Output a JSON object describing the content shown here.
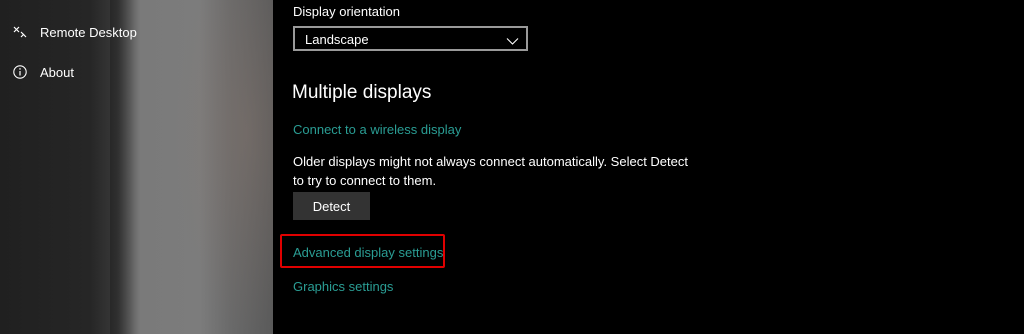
{
  "sidebar": {
    "items": [
      {
        "label": "Remote Desktop",
        "icon": "remote-desktop-icon"
      },
      {
        "label": "About",
        "icon": "info-icon"
      }
    ]
  },
  "main": {
    "orientation": {
      "label": "Display orientation",
      "value": "Landscape"
    },
    "multiple_displays": {
      "title": "Multiple displays",
      "wireless_link": "Connect to a wireless display",
      "description": "Older displays might not always connect automatically. Select Detect to try to connect to them.",
      "detect_button": "Detect"
    },
    "advanced_link": "Advanced display settings",
    "graphics_link": "Graphics settings"
  },
  "colors": {
    "link": "#2a9d94",
    "highlight": "#e00000",
    "button_bg": "#333333"
  }
}
